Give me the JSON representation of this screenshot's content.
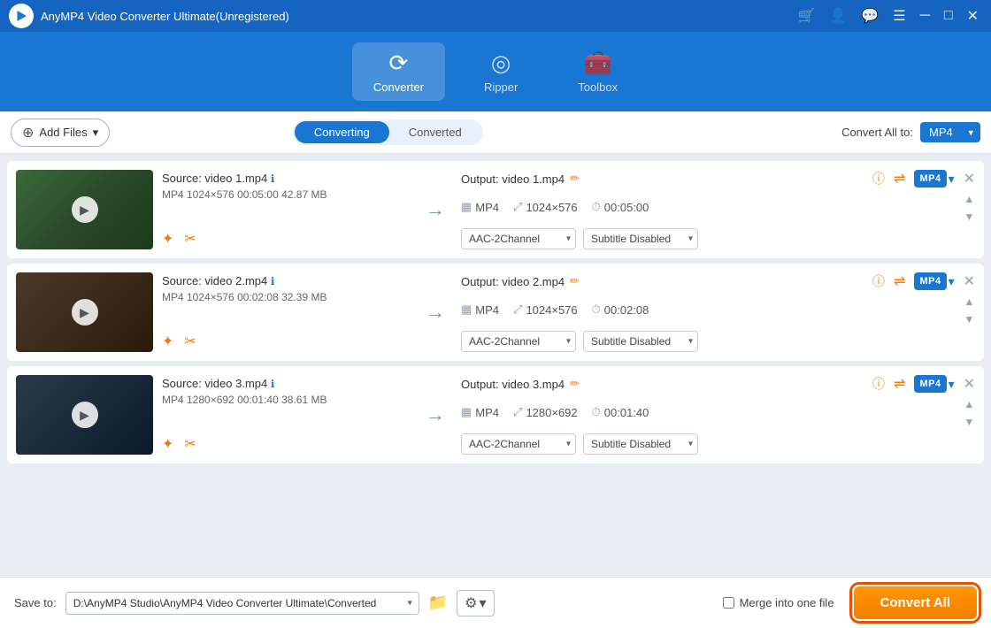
{
  "titlebar": {
    "app_name": "AnyMP4 Video Converter Ultimate(Unregistered)"
  },
  "navbar": {
    "items": [
      {
        "id": "converter",
        "label": "Converter",
        "active": true
      },
      {
        "id": "ripper",
        "label": "Ripper",
        "active": false
      },
      {
        "id": "toolbox",
        "label": "Toolbox",
        "active": false
      }
    ]
  },
  "toolbar": {
    "add_files_label": "Add Files",
    "tabs": [
      {
        "id": "converting",
        "label": "Converting",
        "active": true
      },
      {
        "id": "converted",
        "label": "Converted",
        "active": false
      }
    ],
    "convert_all_to_label": "Convert All to:",
    "format_value": "MP4"
  },
  "videos": [
    {
      "id": 1,
      "source_label": "Source: video 1.mp4",
      "meta": "MP4   1024×576   00:05:00   42.87 MB",
      "output_label": "Output: video 1.mp4",
      "out_format": "MP4",
      "out_resolution": "1024×576",
      "out_duration": "00:05:00",
      "audio_option": "AAC-2Channel",
      "subtitle_option": "Subtitle Disabled",
      "badge": "MP4",
      "thumb_class": "thumb-bg1"
    },
    {
      "id": 2,
      "source_label": "Source: video 2.mp4",
      "meta": "MP4   1024×576   00:02:08   32.39 MB",
      "output_label": "Output: video 2.mp4",
      "out_format": "MP4",
      "out_resolution": "1024×576",
      "out_duration": "00:02:08",
      "audio_option": "AAC-2Channel",
      "subtitle_option": "Subtitle Disabled",
      "badge": "MP4",
      "thumb_class": "thumb-bg2"
    },
    {
      "id": 3,
      "source_label": "Source: video 3.mp4",
      "meta": "MP4   1280×692   00:01:40   38.61 MB",
      "output_label": "Output: video 3.mp4",
      "out_format": "MP4",
      "out_resolution": "1280×692",
      "out_duration": "00:01:40",
      "audio_option": "AAC-2Channel",
      "subtitle_option": "Subtitle Disabled",
      "badge": "MP4",
      "thumb_class": "thumb-bg3"
    }
  ],
  "footer": {
    "save_to_label": "Save to:",
    "path_value": "D:\\AnyMP4 Studio\\AnyMP4 Video Converter Ultimate\\Converted",
    "merge_label": "Merge into one file",
    "convert_all_label": "Convert All"
  }
}
